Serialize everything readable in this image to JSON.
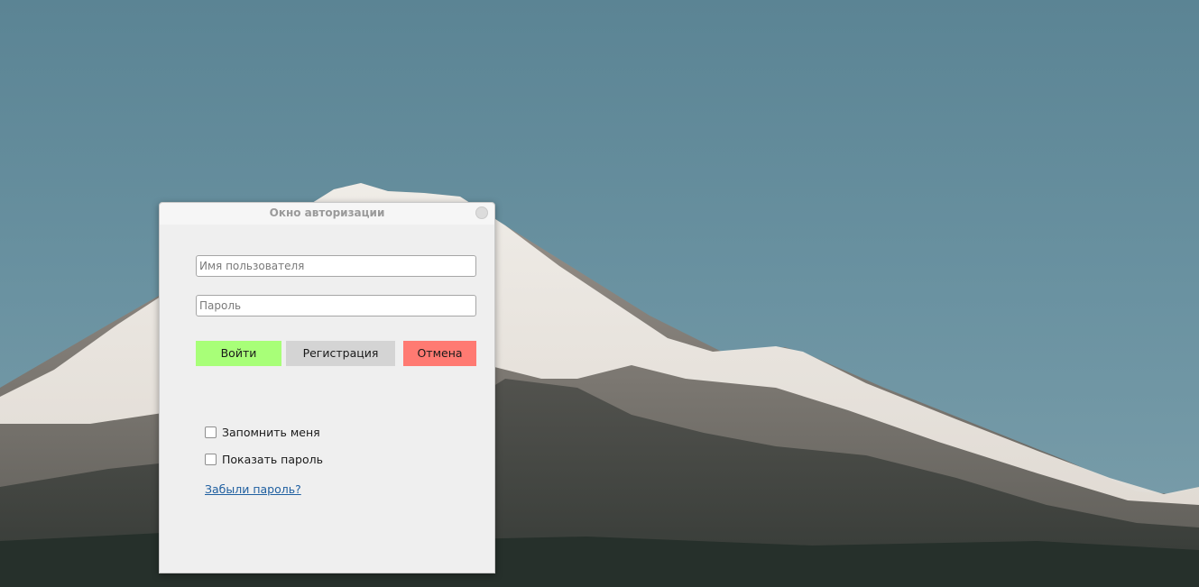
{
  "window": {
    "title": "Окно авторизации"
  },
  "form": {
    "username": {
      "value": "",
      "placeholder": "Имя пользователя"
    },
    "password": {
      "value": "",
      "placeholder": "Пароль"
    }
  },
  "buttons": {
    "login_label": "Войти",
    "register_label": "Регистрация",
    "cancel_label": "Отмена"
  },
  "options": {
    "remember_me": {
      "label": "Запомнить меня",
      "checked": false
    },
    "show_password": {
      "label": "Показать пароль",
      "checked": false
    }
  },
  "links": {
    "forgot_password": "Забыли пароль?"
  },
  "colors": {
    "login": "#a8ff78",
    "register": "#d4d4d4",
    "cancel": "#ff7a72",
    "link": "#1f5fa0"
  }
}
